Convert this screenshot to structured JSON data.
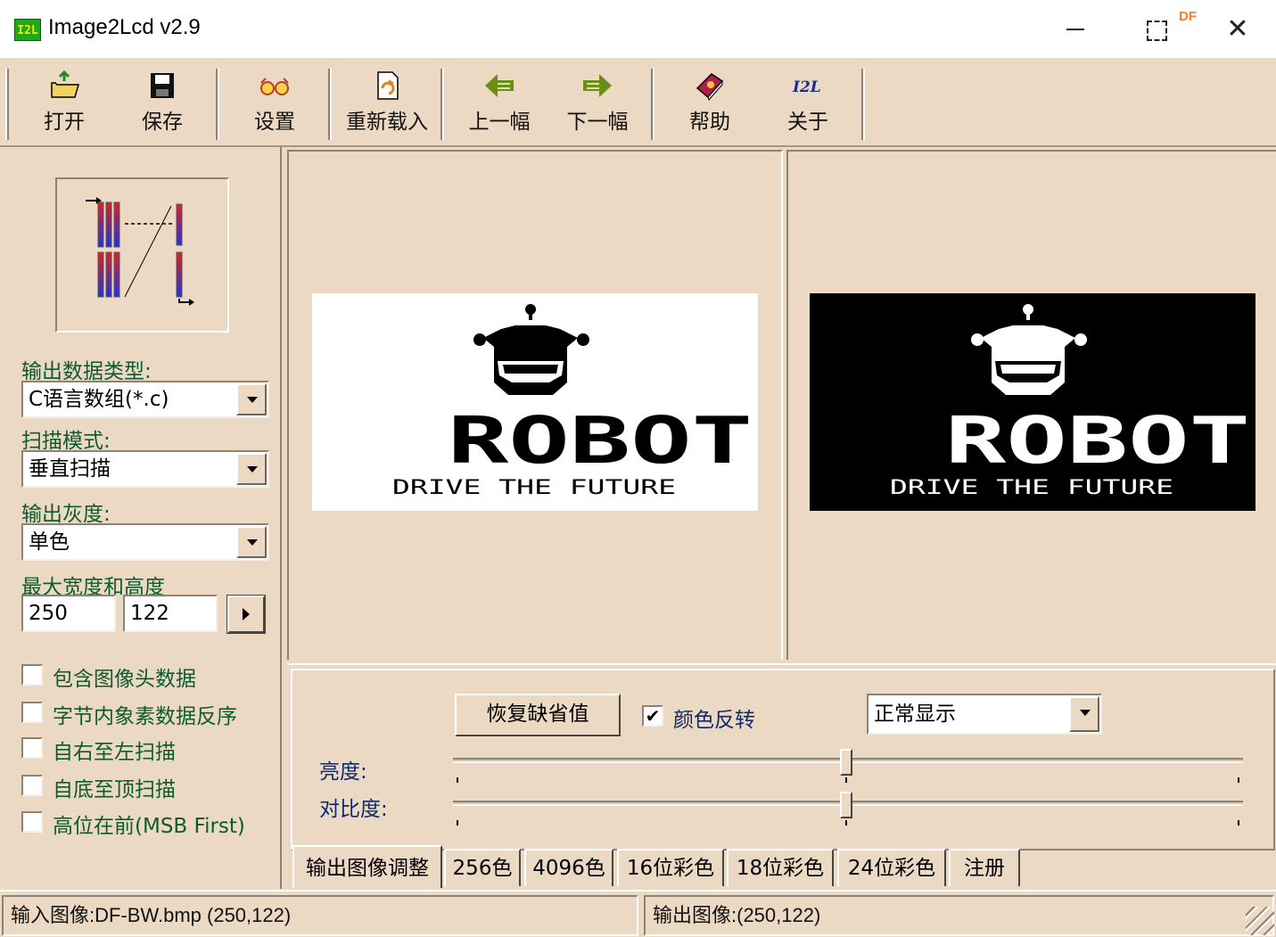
{
  "window": {
    "title": "Image2Lcd v2.9",
    "icon_text": "I2L",
    "badge": "DF",
    "close_glyph": "✕"
  },
  "toolbar": {
    "items": [
      {
        "label": "打开",
        "icon": "open-folder-icon"
      },
      {
        "label": "保存",
        "icon": "floppy-disk-icon"
      },
      {
        "label": "设置",
        "icon": "glasses-icon"
      },
      {
        "label": "重新载入",
        "icon": "reload-icon"
      },
      {
        "label": "上一幅",
        "icon": "arrow-left-icon"
      },
      {
        "label": "下一幅",
        "icon": "arrow-right-icon"
      },
      {
        "label": "帮助",
        "icon": "help-book-icon"
      },
      {
        "label": "关于",
        "icon": "i2l-logo-icon"
      }
    ]
  },
  "settings": {
    "output_type_label": "输出数据类型:",
    "output_type_value": "C语言数组(*.c)",
    "scan_mode_label": "扫描模式:",
    "scan_mode_value": "垂直扫描",
    "gray_label": "输出灰度:",
    "gray_value": "单色",
    "max_size_label": "最大宽度和高度",
    "width": "250",
    "height": "122",
    "options": [
      {
        "label": "包含图像头数据",
        "checked": false
      },
      {
        "label": "字节内象素数据反序",
        "checked": false
      },
      {
        "label": "自右至左扫描",
        "checked": false
      },
      {
        "label": "自底至顶扫描",
        "checked": false
      },
      {
        "label": "高位在前(MSB First)",
        "checked": false
      }
    ]
  },
  "preview": {
    "robot_text": "ROBOT",
    "tagline": "DRIVE THE FUTURE"
  },
  "adjust": {
    "reset_label": "恢复缺省值",
    "invert_label": "颜色反转",
    "invert_checked": true,
    "display_mode": "正常显示",
    "brightness_label": "亮度:",
    "contrast_label": "对比度:",
    "brightness_level": 0.5,
    "contrast_level": 0.5
  },
  "tabs": [
    {
      "label": "输出图像调整",
      "active": true
    },
    {
      "label": "256色",
      "active": false
    },
    {
      "label": "4096色",
      "active": false
    },
    {
      "label": "16位彩色",
      "active": false
    },
    {
      "label": "18位彩色",
      "active": false
    },
    {
      "label": "24位彩色",
      "active": false
    },
    {
      "label": "注册",
      "active": false
    }
  ],
  "status": {
    "input": "输入图像:DF-BW.bmp (250,122)",
    "output": "输出图像:(250,122)"
  },
  "colors": {
    "background": "#ecd9c3",
    "label_green": "#0d5b2f",
    "label_blue": "#0d2a6e"
  }
}
